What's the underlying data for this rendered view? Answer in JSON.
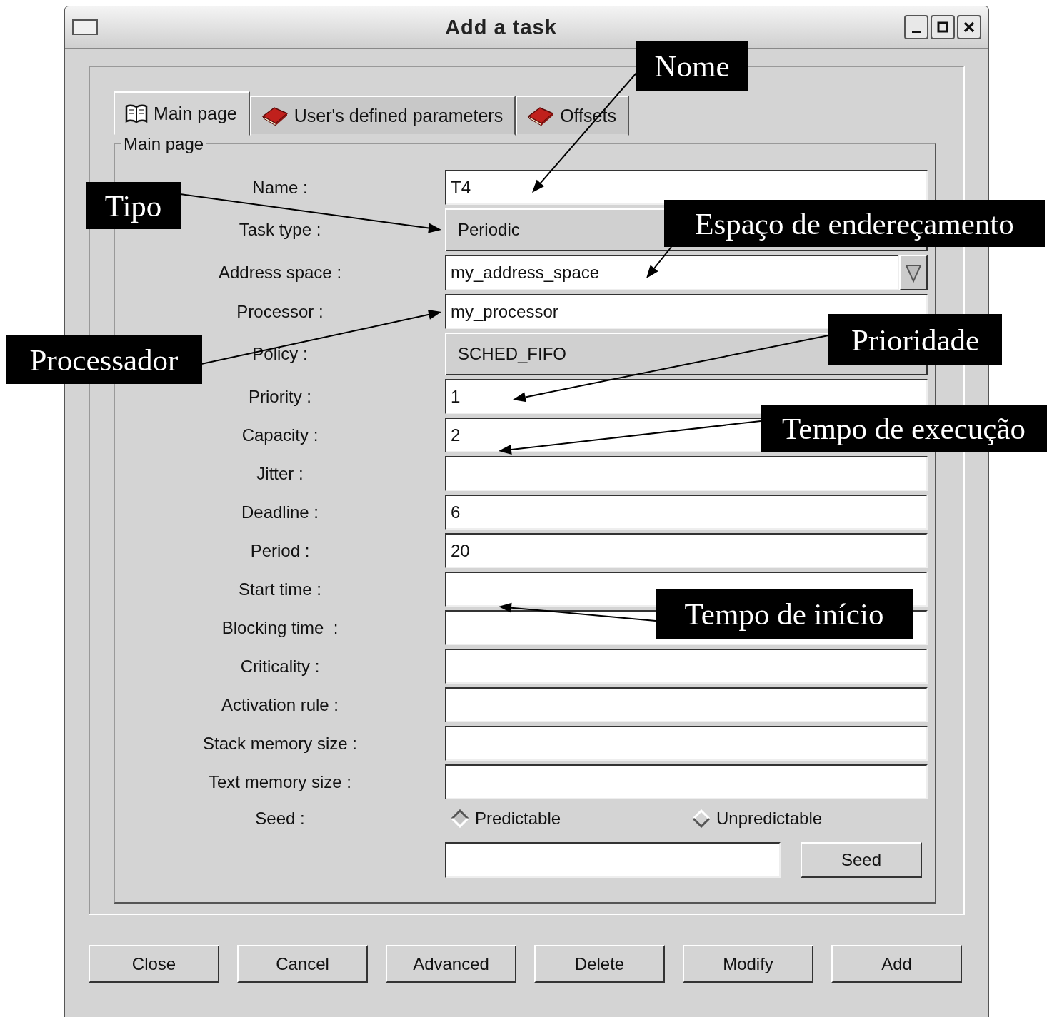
{
  "window": {
    "title": "Add a task"
  },
  "tabs": [
    {
      "label": "Main page",
      "selected": true
    },
    {
      "label": "User's defined parameters",
      "selected": false
    },
    {
      "label": "Offsets",
      "selected": false
    }
  ],
  "group": {
    "title": "Main page"
  },
  "fields": [
    {
      "label": "Name :",
      "kind": "text",
      "value": "T4"
    },
    {
      "label": "Task type :",
      "kind": "option",
      "value": "Periodic"
    },
    {
      "label": "Address space :",
      "kind": "combo",
      "value": "my_address_space"
    },
    {
      "label": "Processor :",
      "kind": "text",
      "value": "my_processor"
    },
    {
      "label": "Policy :",
      "kind": "option",
      "value": "SCHED_FIFO"
    },
    {
      "label": "Priority :",
      "kind": "text",
      "value": "1"
    },
    {
      "label": "Capacity :",
      "kind": "text",
      "value": "2"
    },
    {
      "label": "Jitter :",
      "kind": "text"
    },
    {
      "label": "Deadline :",
      "kind": "text",
      "value": "6"
    },
    {
      "label": "Period :",
      "kind": "text",
      "value": "20"
    },
    {
      "label": "Start time :",
      "kind": "text"
    },
    {
      "label": "Blocking time  :",
      "kind": "text"
    },
    {
      "label": "Criticality :",
      "kind": "text"
    },
    {
      "label": "Activation rule :",
      "kind": "text"
    },
    {
      "label": "Stack memory size :",
      "kind": "text"
    },
    {
      "label": "Text memory size :",
      "kind": "text"
    }
  ],
  "seed": {
    "label": "Seed :",
    "options": [
      {
        "label": "Predictable",
        "selected": true
      },
      {
        "label": "Unpredictable",
        "selected": false
      }
    ],
    "button": "Seed"
  },
  "buttons": [
    "Close",
    "Cancel",
    "Advanced",
    "Delete",
    "Modify",
    "Add"
  ],
  "annotations": [
    {
      "text": "Nome"
    },
    {
      "text": "Tipo"
    },
    {
      "text": "Espaço de endereçamento"
    },
    {
      "text": "Processador"
    },
    {
      "text": "Prioridade"
    },
    {
      "text": "Tempo de execução"
    },
    {
      "text": "Tempo de início"
    }
  ]
}
